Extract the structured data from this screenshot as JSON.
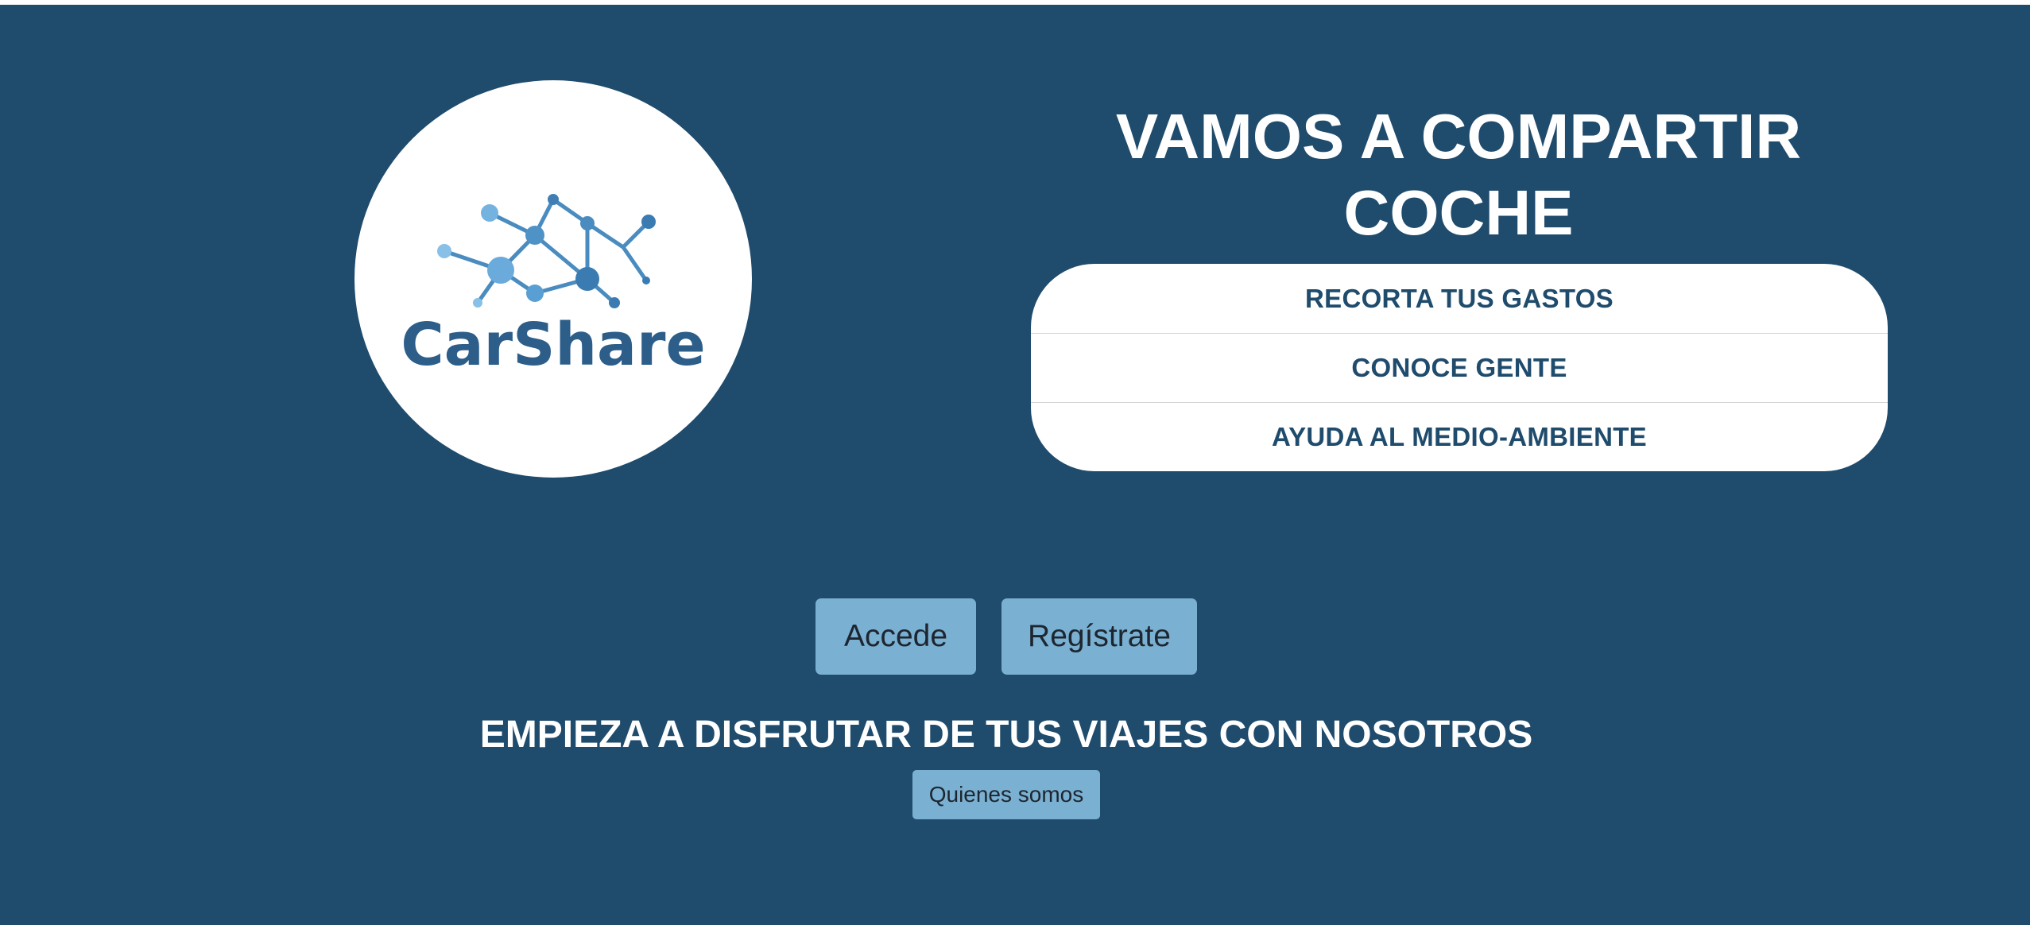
{
  "brand": {
    "logo_text": "CarShare",
    "colors": {
      "background": "#1f4b6c",
      "logo_text": "#2d5e8a",
      "logo_light": "#74b3e0",
      "logo_mid": "#5096cb",
      "logo_dark": "#3a7cb1",
      "button": "#7ab0d1",
      "card": "#ffffff"
    }
  },
  "hero": {
    "title_line1": "VAMOS A COMPARTIR",
    "title_line2": "COCHE"
  },
  "benefits": [
    {
      "label": "RECORTA TUS GASTOS"
    },
    {
      "label": "CONOCE GENTE"
    },
    {
      "label": "AYUDA AL MEDIO-AMBIENTE"
    }
  ],
  "actions": {
    "login_label": "Accede",
    "register_label": "Regístrate"
  },
  "tagline": "EMPIEZA A DISFRUTAR DE TUS VIAJES CON NOSOTROS",
  "about_label": "Quienes somos"
}
